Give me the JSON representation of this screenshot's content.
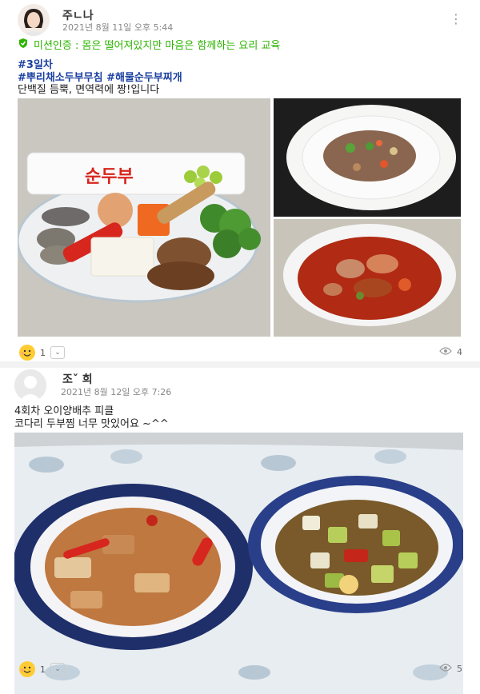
{
  "post1": {
    "author": "주ㄴ나",
    "date": "2021년 8월 11일 오후 5:44",
    "mission": "미션인증 : 몸은 떨어져있지만 마음은 함께하는 요리 교육",
    "tags": [
      "#3일차",
      "#뿌리채소두부무침 #해물순두부찌개"
    ],
    "text": "단백질 듬뿍, 면역력에 짱!입니다",
    "package_label": "순두부",
    "reaction_count": "1",
    "view_count": "4"
  },
  "post2": {
    "author": "조ˇ 희",
    "date": "2021년 8월 12일 오후 7:26",
    "lines": [
      "4회차  오이양배추 피클",
      "코다리 두부찜  너무  맛있어요 ~^^"
    ],
    "reaction_count": "1",
    "view_count": "5"
  },
  "colors": {
    "mission_green": "#2db400",
    "tag_blue": "#1a3fa0",
    "emoji_yellow": "#ffcc33"
  },
  "icons": [
    "more-vert-icon",
    "mission-check-icon",
    "emoji-reaction-icon",
    "chevron-down-icon",
    "eye-icon"
  ]
}
